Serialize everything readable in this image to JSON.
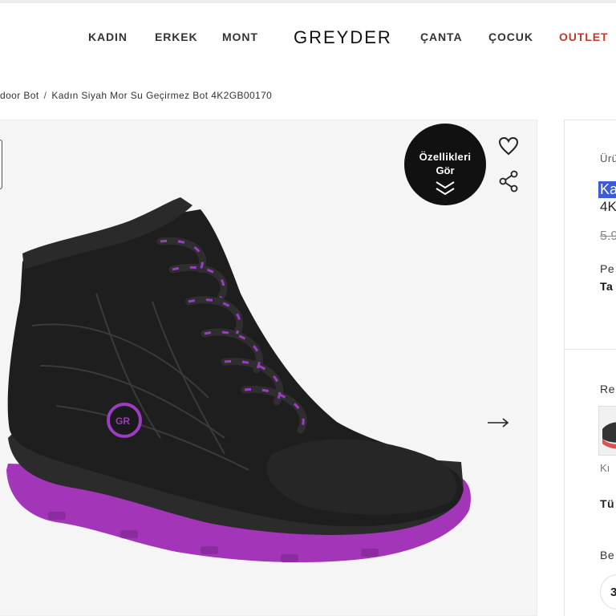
{
  "header": {
    "logo": "GREYDER",
    "nav": [
      {
        "label": "KADIN"
      },
      {
        "label": "ERKEK"
      },
      {
        "label": "MONT"
      },
      {
        "label": "ÇANTA"
      },
      {
        "label": "ÇOCUK"
      },
      {
        "label": "OUTLET"
      }
    ],
    "accent_color": "#c0392b"
  },
  "breadcrumb": {
    "items": [
      "door Bot",
      "Kadın Siyah Mor Su Geçirmez Bot 4K2GB00170"
    ],
    "separator": "/"
  },
  "gallery": {
    "features_line1": "Özellikleri",
    "features_line2": "Gör",
    "icons": [
      "heart-icon",
      "share-icon",
      "arrow-right-icon",
      "chevron-down-icon"
    ]
  },
  "product_panel": {
    "label_partial": "Ürü",
    "name_line1_partial": "Ka",
    "name_line2_partial": "4K",
    "old_price_partial": "5.9",
    "info_label_partial": "Pe",
    "info_value_partial": "Ta",
    "section_label_partial": "Re",
    "swatch_caption_partial": "Kı",
    "all_link_partial": "Tü",
    "size_label_partial": "Be",
    "size_value_partial": "3",
    "highlight_color": "#3d5bd9"
  }
}
